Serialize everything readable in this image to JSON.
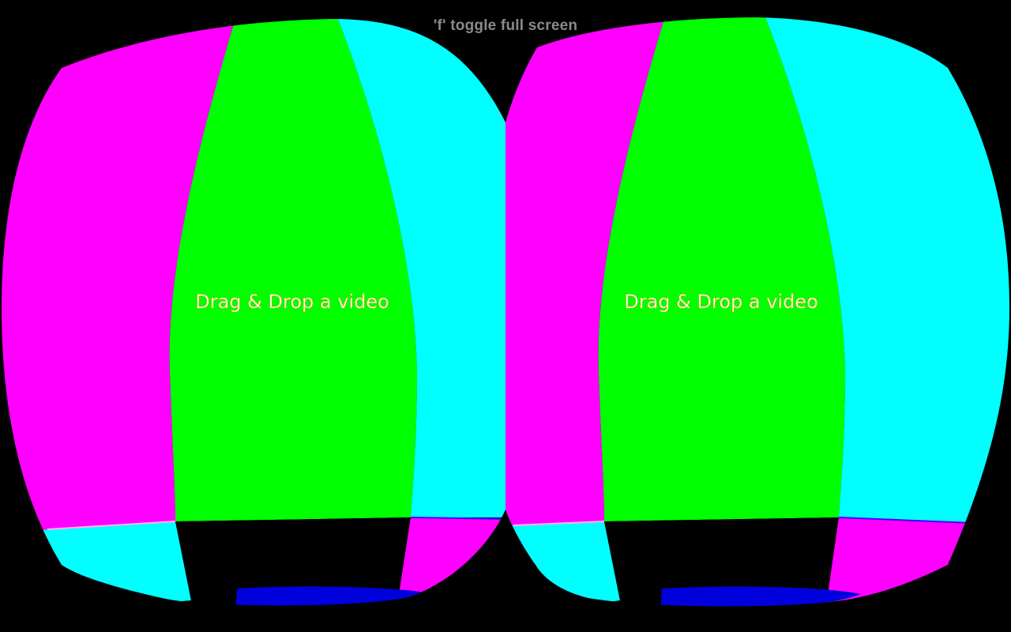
{
  "toolbar": {
    "fullscreen_hint": "'f' toggle full screen"
  },
  "left_eye": {
    "drop_label": "Drag & Drop a video"
  },
  "right_eye": {
    "drop_label": "Drag & Drop a video"
  },
  "colors": {
    "background": "#000000",
    "magenta": "#ff00ff",
    "green": "#00ff00",
    "cyan": "#00ffff",
    "blue": "#0000dd",
    "hint_text": "#8a8a8a"
  }
}
